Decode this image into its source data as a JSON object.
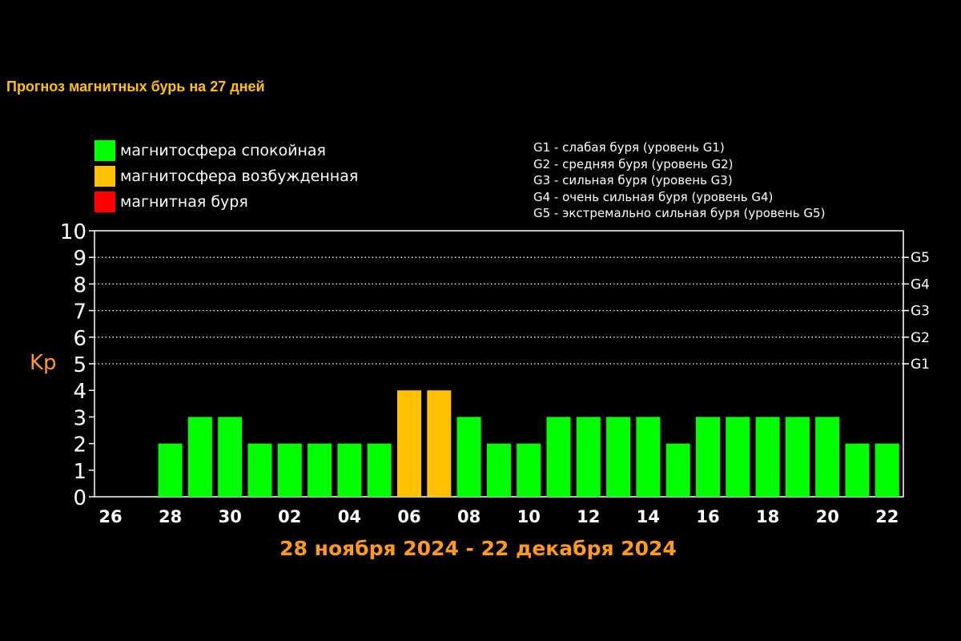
{
  "title": "Прогноз магнитных бурь на 27 дней",
  "legend": [
    {
      "label": "магнитосфера спокойная",
      "color": "#00ff00"
    },
    {
      "label": "магнитосфера возбужденная",
      "color": "#ffc000"
    },
    {
      "label": "магнитная буря",
      "color": "#ff0000"
    }
  ],
  "storm_levels": [
    "G1 - слабая буря (уровень G1)",
    "G2 - средняя буря (уровень G2)",
    "G3 - сильная буря (уровень G3)",
    "G4 - очень сильная буря (уровень G4)",
    "G5 - экстремально сильная буря (уровень G5)"
  ],
  "chart_data": {
    "type": "bar",
    "ylabel": "Kp",
    "xlabel": "28 ноября 2024 - 22 декабря 2024",
    "ylim": [
      0,
      10
    ],
    "yticks": [
      "0",
      "1",
      "2",
      "3",
      "4",
      "5",
      "6",
      "7",
      "8",
      "9",
      "10"
    ],
    "right_labels": [
      {
        "value": 5,
        "label": "G1"
      },
      {
        "value": 6,
        "label": "G2"
      },
      {
        "value": 7,
        "label": "G3"
      },
      {
        "value": 8,
        "label": "G4"
      },
      {
        "value": 9,
        "label": "G5"
      }
    ],
    "dotted_grid_values": [
      5,
      6,
      7,
      8,
      9
    ],
    "x_tick_labels": [
      "26",
      "28",
      "30",
      "02",
      "04",
      "06",
      "08",
      "10",
      "12",
      "14",
      "16",
      "18",
      "20",
      "22"
    ],
    "categories": [
      "26",
      "27",
      "28",
      "29",
      "30",
      "01",
      "02",
      "03",
      "04",
      "05",
      "06",
      "07",
      "08",
      "09",
      "10",
      "11",
      "12",
      "13",
      "14",
      "15",
      "16",
      "17",
      "18",
      "19",
      "20",
      "21",
      "22"
    ],
    "values": [
      null,
      null,
      2,
      3,
      3,
      2,
      2,
      2,
      2,
      2,
      4,
      4,
      3,
      2,
      2,
      3,
      3,
      3,
      3,
      2,
      3,
      3,
      3,
      3,
      3,
      2,
      2
    ],
    "bar_colors": [
      "",
      "",
      "#00ff00",
      "#00ff00",
      "#00ff00",
      "#00ff00",
      "#00ff00",
      "#00ff00",
      "#00ff00",
      "#00ff00",
      "#ffc000",
      "#ffc000",
      "#00ff00",
      "#00ff00",
      "#00ff00",
      "#00ff00",
      "#00ff00",
      "#00ff00",
      "#00ff00",
      "#00ff00",
      "#00ff00",
      "#00ff00",
      "#00ff00",
      "#00ff00",
      "#00ff00",
      "#00ff00",
      "#00ff00"
    ]
  }
}
